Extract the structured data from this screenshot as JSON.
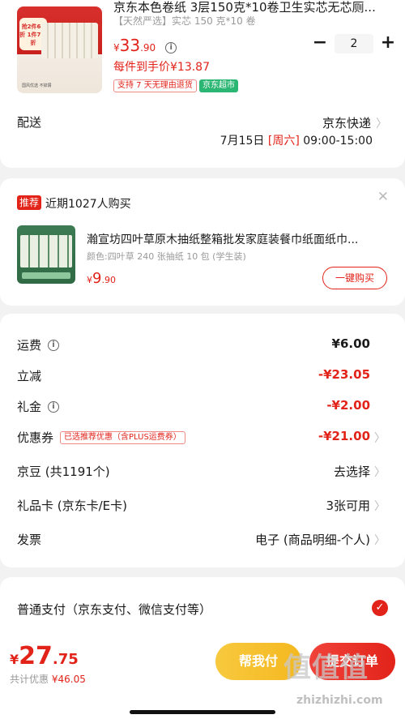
{
  "product": {
    "title": "京东本色卷纸 3层150克*10卷卫生实芯无芯厕...",
    "spec": "【天然严选】实芯 150 克*10 卷",
    "price": {
      "yen": "¥",
      "int": "33",
      "dec": ".90"
    },
    "per_unit_price": "每件到手价¥13.87",
    "quantity": "2",
    "tag_return": "支持 7 天无理由退货",
    "tag_market": "京东超市",
    "image_badge": "抢2件68折 1件7.5折",
    "image_footer": "国风优选 不掉屑"
  },
  "delivery": {
    "label": "配送",
    "method": "京东快递",
    "date": "7月15日",
    "weekday": "[周六]",
    "time": "09:00-15:00"
  },
  "recommend": {
    "badge": "推荐",
    "title": "近期1027人购买",
    "item_name": "瀚宣坊四叶草原木抽纸整箱批发家庭装餐巾纸面纸巾...",
    "item_spec": "颜色:四叶草 240 张抽纸 10 包 (学生装)",
    "price": {
      "yen": "¥",
      "int": "9",
      "dec": ".90"
    },
    "buy_label": "一键购买"
  },
  "fees": [
    {
      "label": "运费",
      "value": "¥6.00",
      "info": true,
      "red": false,
      "bold": false,
      "chevron": false
    },
    {
      "label": "立减",
      "value": "-¥23.05",
      "info": false,
      "red": true,
      "bold": false,
      "chevron": false
    },
    {
      "label": "礼金",
      "value": "-¥2.00",
      "info": true,
      "red": true,
      "bold": false,
      "chevron": false
    },
    {
      "label": "优惠券",
      "value": "-¥21.00",
      "info": false,
      "red": true,
      "bold": false,
      "chevron": true
    },
    {
      "label": "京豆 (共1191个)",
      "value": "去选择",
      "info": false,
      "red": false,
      "bold": false,
      "chevron": true
    },
    {
      "label": "礼品卡 (京东卡/E卡)",
      "value": "3张可用",
      "info": false,
      "red": false,
      "bold": false,
      "chevron": true
    },
    {
      "label": "发票",
      "value": "电子 (商品明细-个人)",
      "info": false,
      "red": false,
      "bold": false,
      "chevron": true
    }
  ],
  "coupon_tag": "已选推荐优惠（含PLUS运费券）",
  "payment": {
    "label": "普通支付（京东支付、微信支付等）"
  },
  "bottom": {
    "total": {
      "yen": "¥",
      "int": "27",
      "dec": ".75"
    },
    "discount_label": "共计优惠",
    "discount_amount": "¥46.05",
    "help_pay_label": "帮我付",
    "submit_label": "提交订单"
  },
  "watermark": {
    "text": "值值值",
    "url": "zhizhizhi.com"
  },
  "colors": {
    "accent": "#e2231a",
    "market_green": "#2bb673",
    "help_yellow": "#f4b820"
  }
}
